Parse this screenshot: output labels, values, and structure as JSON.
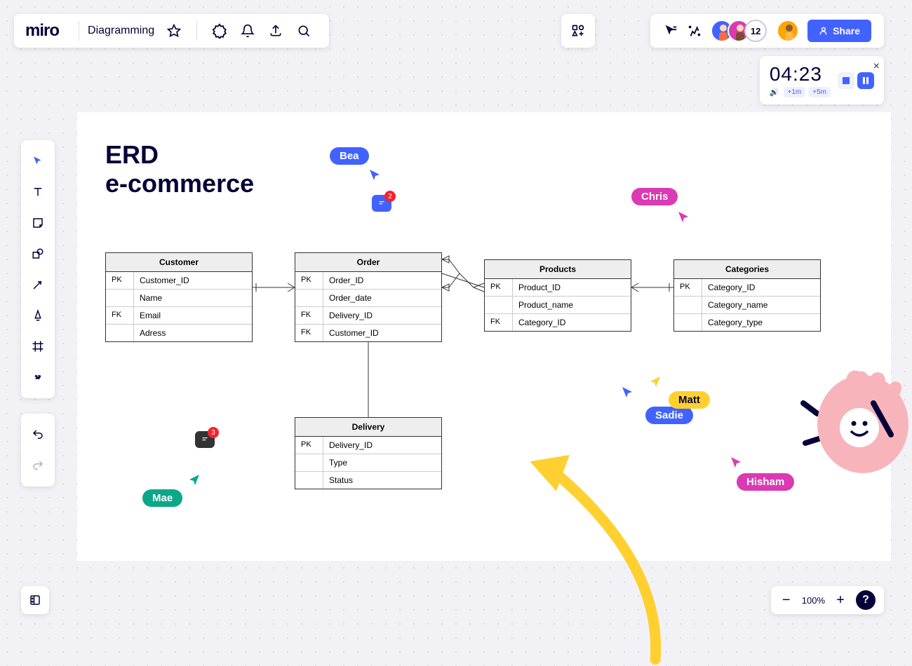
{
  "header": {
    "logo": "miro",
    "board_name": "Diagramming"
  },
  "share": {
    "label": "Share"
  },
  "collab": {
    "count": "12"
  },
  "timer": {
    "time": "04:23",
    "add1": "+1m",
    "add5": "+5m"
  },
  "zoom": {
    "level": "100%"
  },
  "canvas": {
    "title_line1": "ERD",
    "title_line2": "e-commerce"
  },
  "entities": {
    "customer": {
      "name": "Customer",
      "rows": [
        {
          "key": "PK",
          "field": "Customer_ID"
        },
        {
          "key": "",
          "field": "Name"
        },
        {
          "key": "FK",
          "field": "Email"
        },
        {
          "key": "",
          "field": "Adress"
        }
      ]
    },
    "order": {
      "name": "Order",
      "rows": [
        {
          "key": "PK",
          "field": "Order_ID"
        },
        {
          "key": "",
          "field": "Order_date"
        },
        {
          "key": "FK",
          "field": "Delivery_ID"
        },
        {
          "key": "FK",
          "field": "Customer_ID"
        }
      ]
    },
    "products": {
      "name": "Products",
      "rows": [
        {
          "key": "PK",
          "field": "Product_ID"
        },
        {
          "key": "",
          "field": "Product_name"
        },
        {
          "key": "FK",
          "field": "Category_ID"
        }
      ]
    },
    "categories": {
      "name": "Categories",
      "rows": [
        {
          "key": "PK",
          "field": "Category_ID"
        },
        {
          "key": "",
          "field": "Category_name"
        },
        {
          "key": "",
          "field": "Category_type"
        }
      ]
    },
    "delivery": {
      "name": "Delivery",
      "rows": [
        {
          "key": "PK",
          "field": "Delivery_ID"
        },
        {
          "key": "",
          "field": "Type"
        },
        {
          "key": "",
          "field": "Status"
        }
      ]
    }
  },
  "users": {
    "bea": "Bea",
    "chris": "Chris",
    "mae": "Mae",
    "sadie": "Sadie",
    "matt": "Matt",
    "hisham": "Hisham"
  },
  "comments": {
    "c1": "2",
    "c2": "3"
  }
}
